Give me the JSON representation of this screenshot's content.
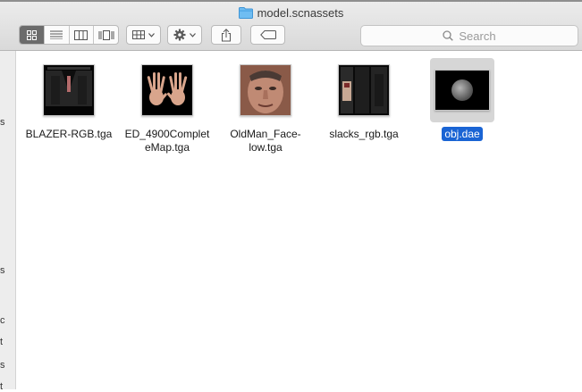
{
  "window": {
    "title": "model.scnassets"
  },
  "toolbar": {
    "view_modes": [
      "icon-view",
      "list-view",
      "column-view",
      "cover-flow-view"
    ],
    "active_view": "icon-view",
    "arrange_icon": "arrange-grid-icon",
    "action_icon": "gear-icon",
    "share_icon": "share-icon",
    "tags_icon": "tag-icon"
  },
  "search": {
    "placeholder": "Search"
  },
  "sidebar": {
    "visible_letters": [
      "s",
      "s",
      "c",
      "t",
      "s",
      "t"
    ]
  },
  "files": [
    {
      "name_line1": "BLAZER-RGB.tga",
      "name_line2": "",
      "thumb": "blazer-texture",
      "selected": false
    },
    {
      "name_line1": "ED_4900Complet",
      "name_line2": "eMap.tga",
      "thumb": "hands-texture",
      "selected": false
    },
    {
      "name_line1": "OldMan_Face-",
      "name_line2": "low.tga",
      "thumb": "face-texture",
      "selected": false
    },
    {
      "name_line1": "slacks_rgb.tga",
      "name_line2": "",
      "thumb": "slacks-texture",
      "selected": false
    },
    {
      "name_line1": "obj.dae",
      "name_line2": "",
      "thumb": "collada-scene",
      "selected": true
    }
  ],
  "colors": {
    "selection": "#1a64d4",
    "folder": "#5fb3ee",
    "toolbar_bg": "#dcdcdc"
  }
}
